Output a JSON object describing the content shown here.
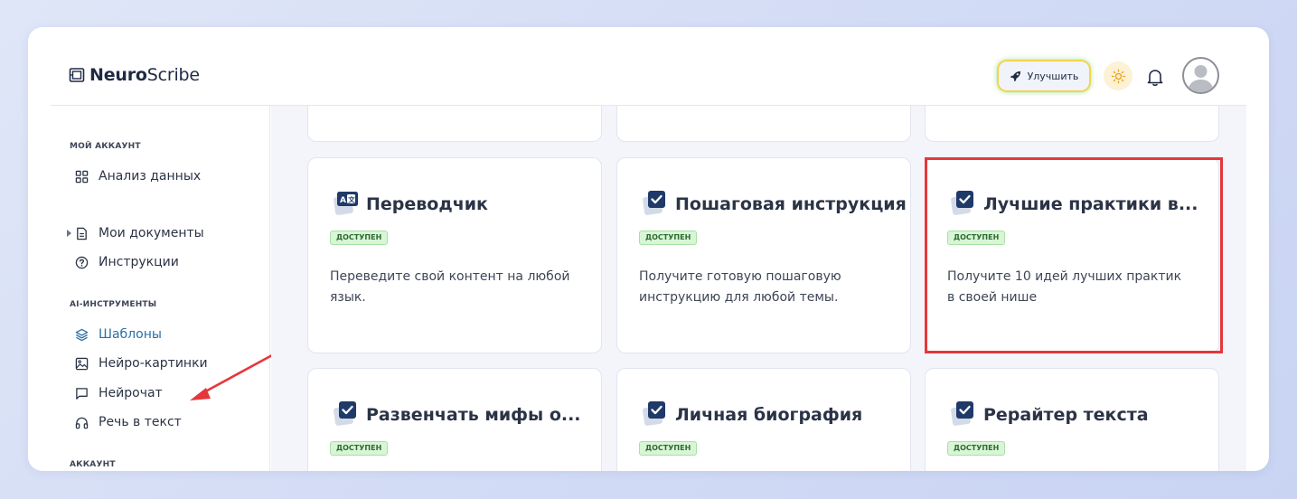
{
  "app": {
    "logo_bold": "Neuro",
    "logo_light": "Scribe"
  },
  "header": {
    "upgrade_label": "Улучшить"
  },
  "sidebar": {
    "sections": [
      {
        "title": "МОЙ АККАУНТ"
      },
      {
        "title": "AI-ИНСТРУМЕНТЫ"
      },
      {
        "title": "АККАУНТ"
      }
    ],
    "items": [
      {
        "label": "Анализ данных",
        "icon": "grid-icon"
      },
      {
        "label": "Мои документы",
        "icon": "document-icon"
      },
      {
        "label": "Инструкции",
        "icon": "help-circle-icon"
      },
      {
        "label": "Шаблоны",
        "icon": "layers-icon",
        "active": true
      },
      {
        "label": "Нейро-картинки",
        "icon": "image-icon"
      },
      {
        "label": "Нейрочат",
        "icon": "chat-icon"
      },
      {
        "label": "Речь в текст",
        "icon": "headphones-icon"
      }
    ]
  },
  "cards": [
    {
      "title": "Переводчик",
      "badge": "ДОСТУПЕН",
      "desc_line1": "Переведите свой контент на любой",
      "desc_line2": "язык.",
      "icon": "translate-icon"
    },
    {
      "title": "Пошаговая инструкция",
      "badge": "ДОСТУПЕН",
      "desc_line1": "Получите готовую пошаговую",
      "desc_line2": "инструкцию для любой темы.",
      "icon": "checkbox-icon"
    },
    {
      "title": "Лучшие практики в...",
      "badge": "ДОСТУПЕН",
      "desc_line1": "Получите 10 идей лучших практик",
      "desc_line2": "в своей нише",
      "icon": "checkbox-icon"
    },
    {
      "title": "Развенчать мифы о...",
      "badge": "ДОСТУПЕН",
      "icon": "checkbox-icon"
    },
    {
      "title": "Личная биография",
      "badge": "ДОСТУПЕН",
      "icon": "checkbox-icon"
    },
    {
      "title": "Рерайтер текста",
      "badge": "ДОСТУПЕН",
      "icon": "checkbox-icon"
    }
  ],
  "colors": {
    "accent": "#2a6fa6",
    "highlight": "#e5373b",
    "badge_bg": "#d8f5d6",
    "icon_navy": "#1f3a68"
  }
}
